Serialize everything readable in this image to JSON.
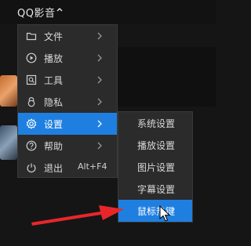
{
  "app": {
    "title": "QQ影音"
  },
  "menu": {
    "items": [
      {
        "label": "文件",
        "icon": "folder-icon",
        "has_submenu": true
      },
      {
        "label": "播放",
        "icon": "play-circle-icon",
        "has_submenu": true
      },
      {
        "label": "工具",
        "icon": "toolbox-icon",
        "has_submenu": true
      },
      {
        "label": "隐私",
        "icon": "lock-icon",
        "has_submenu": true
      },
      {
        "label": "设置",
        "icon": "gear-icon",
        "has_submenu": true,
        "active": true
      },
      {
        "label": "帮助",
        "icon": "help-circle-icon",
        "has_submenu": true
      },
      {
        "label": "退出",
        "icon": "power-icon",
        "shortcut": "Alt+F4"
      }
    ]
  },
  "submenu": {
    "items": [
      {
        "label": "系统设置"
      },
      {
        "label": "播放设置"
      },
      {
        "label": "图片设置"
      },
      {
        "label": "字幕设置"
      },
      {
        "label": "鼠标热键",
        "active": true
      }
    ]
  },
  "colors": {
    "accent": "#1f7fe0",
    "menu_bg": "#2b2b2b",
    "annotation_arrow": "#e8262a"
  }
}
